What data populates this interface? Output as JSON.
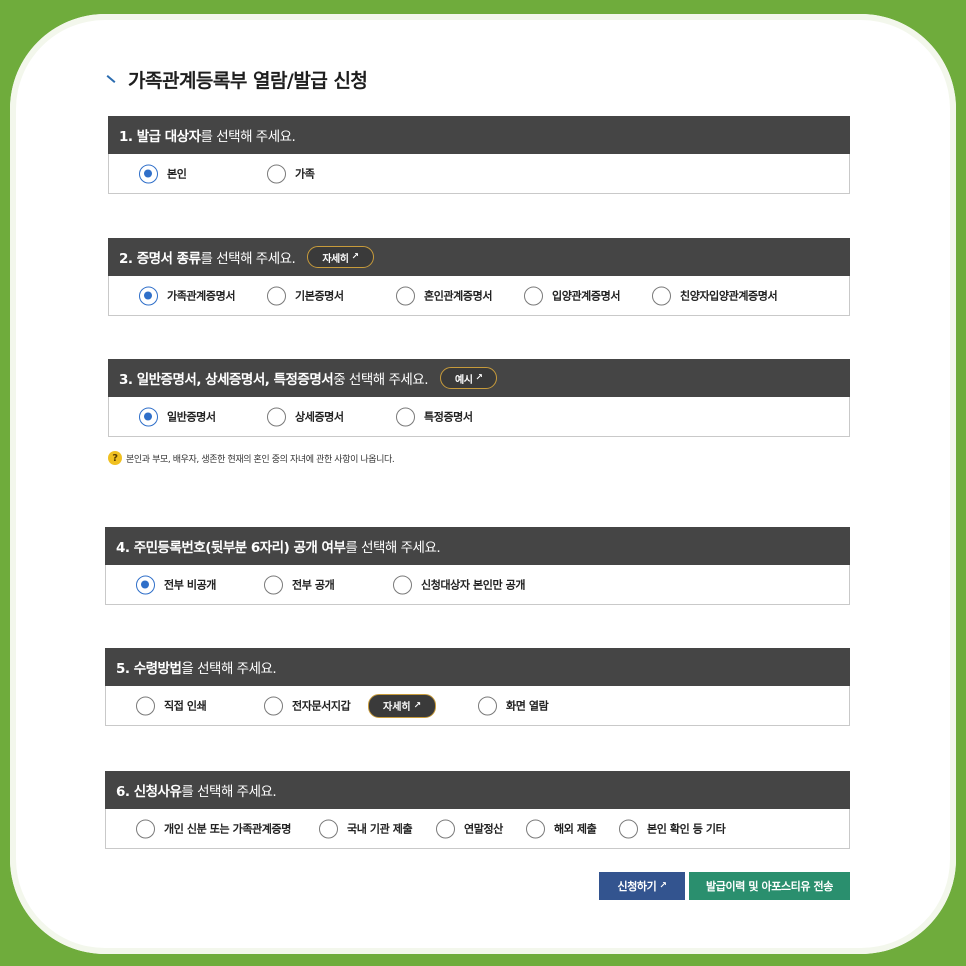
{
  "page": {
    "title": "가족관계등록부 열람/발급 신청"
  },
  "sections": [
    {
      "head_bold": "1. 발급 대상자",
      "head_rest": "를 선택해 주세요.",
      "options": [
        "본인",
        "가족"
      ],
      "selected": 0
    },
    {
      "head_bold": "2. 증명서 종류",
      "head_rest": "를 선택해 주세요.",
      "head_button": "자세히",
      "options": [
        "가족관계증명서",
        "기본증명서",
        "혼인관계증명서",
        "입양관계증명서",
        "친양자입양관계증명서"
      ],
      "selected": 0
    },
    {
      "head_bold": "3. 일반증명서, 상세증명서, 특정증명서",
      "head_rest": " 중 선택해 주세요.",
      "head_button": "예시",
      "options": [
        "일반증명서",
        "상세증명서",
        "특정증명서"
      ],
      "selected": 0,
      "note": "본인과 부모, 배우자, 생존한 현재의 혼인 중의 자녀에 관한 사항이 나옵니다."
    },
    {
      "head_bold": "4. 주민등록번호(뒷부분 6자리) 공개 여부",
      "head_rest": "를 선택해 주세요.",
      "options": [
        "전부 비공개",
        "전부 공개",
        "신청대상자 본인만 공개"
      ],
      "selected": 0
    },
    {
      "head_bold": "5. 수령방법",
      "head_rest": "을 선택해 주세요.",
      "options": [
        "직접 인쇄",
        "전자문서지갑",
        "화면 열람"
      ],
      "inline_button": "자세히",
      "selected": -1
    },
    {
      "head_bold": "6. 신청사유",
      "head_rest": "를 선택해 주세요.",
      "options": [
        "개인 신분 또는 가족관계증명",
        "국내 기관 제출",
        "연말정산",
        "해외 제출",
        "본인 확인 등 기타"
      ],
      "selected": -1
    }
  ],
  "buttons": {
    "apply": "신청하기",
    "send": "발급이력 및 아포스티유 전송"
  }
}
